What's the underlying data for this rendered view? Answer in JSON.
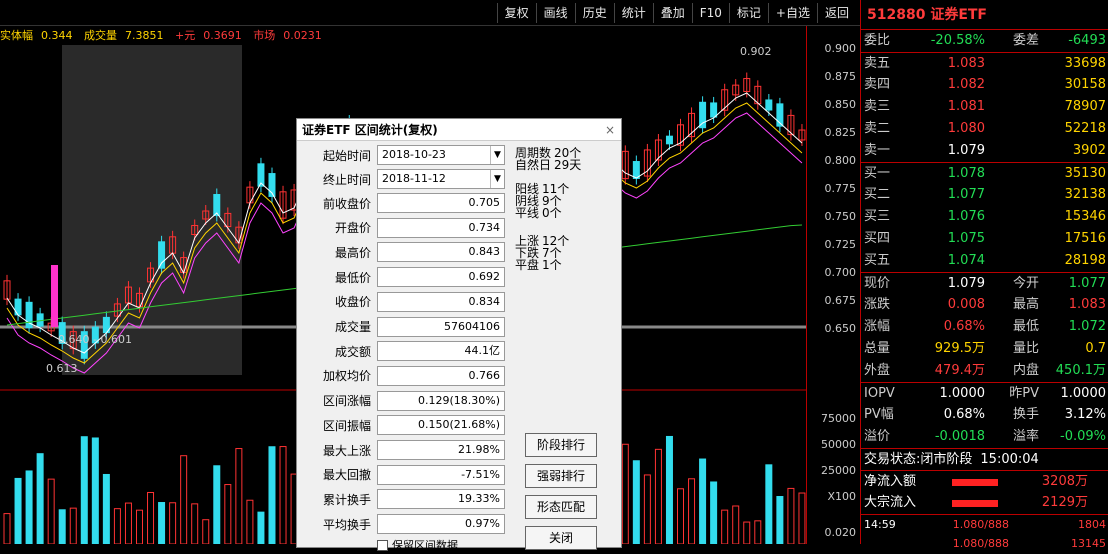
{
  "toolbar": {
    "items": [
      "复权",
      "画线",
      "历史",
      "统计",
      "叠加",
      "F10",
      "标记",
      "+自选",
      "返回"
    ]
  },
  "infoline": {
    "label1": "实体幅",
    "val1": "0.344",
    "label2": "成交量",
    "val2": "7.3851",
    "val3": "+元",
    "val4": "0.3691",
    "val5": "市场",
    "val6": "0.0231"
  },
  "chart": {
    "high_label": "0.902",
    "low_label": "0.613",
    "range_label": "0.640 - 0.601",
    "vol_axis": [
      "75000",
      "50000",
      "25000",
      "X100"
    ],
    "price_ticks": [
      "0.900",
      "0.875",
      "0.850",
      "0.825",
      "0.800",
      "0.775",
      "0.750",
      "0.725",
      "0.700",
      "0.675",
      "0.650",
      "0.020"
    ],
    "colors": {
      "up": "#ff3333",
      "down": "#33ddee",
      "ma5": "#ffffff",
      "ma10": "#ffd400",
      "ma20": "#ff44ff",
      "ma60": "#33cc33"
    }
  },
  "quote": {
    "title": "512880 证券ETF",
    "weibi": {
      "l": "委比",
      "v": "-20.58%",
      "l2": "委差",
      "v2": "-6493"
    },
    "asks": [
      {
        "l": "卖五",
        "p": "1.083",
        "q": "33698"
      },
      {
        "l": "卖四",
        "p": "1.082",
        "q": "30158"
      },
      {
        "l": "卖三",
        "p": "1.081",
        "q": "78907"
      },
      {
        "l": "卖二",
        "p": "1.080",
        "q": "52218"
      },
      {
        "l": "卖一",
        "p": "1.079",
        "q": "3902"
      }
    ],
    "bids": [
      {
        "l": "买一",
        "p": "1.078",
        "q": "35130"
      },
      {
        "l": "买二",
        "p": "1.077",
        "q": "32138"
      },
      {
        "l": "买三",
        "p": "1.076",
        "q": "15346"
      },
      {
        "l": "买四",
        "p": "1.075",
        "q": "17516"
      },
      {
        "l": "买五",
        "p": "1.074",
        "q": "28198"
      }
    ],
    "stats": [
      {
        "l": "现价",
        "v": "1.079",
        "l2": "今开",
        "v2": "1.077"
      },
      {
        "l": "涨跌",
        "v": "0.008",
        "l2": "最高",
        "v2": "1.083"
      },
      {
        "l": "涨幅",
        "v": "0.68%",
        "l2": "最低",
        "v2": "1.072"
      },
      {
        "l": "总量",
        "v": "929.5万",
        "l2": "量比",
        "v2": "0.7"
      },
      {
        "l": "外盘",
        "v": "479.4万",
        "l2": "内盘",
        "v2": "450.1万"
      }
    ],
    "iopv": [
      {
        "l": "IOPV",
        "v": "1.0000",
        "l2": "昨PV",
        "v2": "1.0000"
      },
      {
        "l": "PV幅",
        "v": "0.68%",
        "l2": "换手",
        "v2": "3.12%"
      },
      {
        "l": "溢价",
        "v": "-0.0018",
        "l2": "溢率",
        "v2": "-0.09%"
      }
    ],
    "status_label": "交易状态:",
    "status_value": "闭市阶段",
    "status_time": "15:00:04",
    "flows": [
      {
        "l": "净流入额",
        "v": "3208万"
      },
      {
        "l": "大宗流入",
        "v": "2129万"
      }
    ],
    "ticks": [
      {
        "t": "14:59",
        "p": "1.080/888",
        "v": "1804"
      },
      {
        "t": "",
        "p": "1.080/888",
        "v": "13145"
      }
    ]
  },
  "dialog": {
    "title": "证券ETF 区间统计(复权)",
    "close": "×",
    "start_label": "起始时间",
    "start_value": "2018-10-23",
    "end_label": "终止时间",
    "end_value": "2018-11-12",
    "fields": [
      {
        "label": "前收盘价",
        "value": "0.705"
      },
      {
        "label": "开盘价",
        "value": "0.734"
      },
      {
        "label": "最高价",
        "value": "0.843"
      },
      {
        "label": "最低价",
        "value": "0.692"
      },
      {
        "label": "收盘价",
        "value": "0.834"
      },
      {
        "label": "成交量",
        "value": "57604106"
      },
      {
        "label": "成交额",
        "value": "44.1亿"
      },
      {
        "label": "加权均价",
        "value": "0.766"
      },
      {
        "label": "区间涨幅",
        "value": "0.129(18.30%)"
      },
      {
        "label": "区间振幅",
        "value": "0.150(21.68%)"
      },
      {
        "label": "最大上涨",
        "value": "21.98%"
      },
      {
        "label": "最大回撤",
        "value": "-7.51%"
      },
      {
        "label": "累计换手",
        "value": "19.33%"
      },
      {
        "label": "平均换手",
        "value": "0.97%"
      }
    ],
    "stats": [
      {
        "label": "周期数",
        "value": "20个"
      },
      {
        "label": "自然日",
        "value": "29天"
      },
      {
        "label": "阳线",
        "value": "11个"
      },
      {
        "label": "阴线",
        "value": "9个"
      },
      {
        "label": "平线",
        "value": "0个"
      },
      {
        "label": "上涨",
        "value": "12个"
      },
      {
        "label": "下跌",
        "value": "7个"
      },
      {
        "label": "平盘",
        "value": "1个"
      }
    ],
    "buttons": [
      "阶段排行",
      "强弱排行",
      "形态匹配",
      "关闭"
    ],
    "checkbox_label": "保留区间数据"
  }
}
